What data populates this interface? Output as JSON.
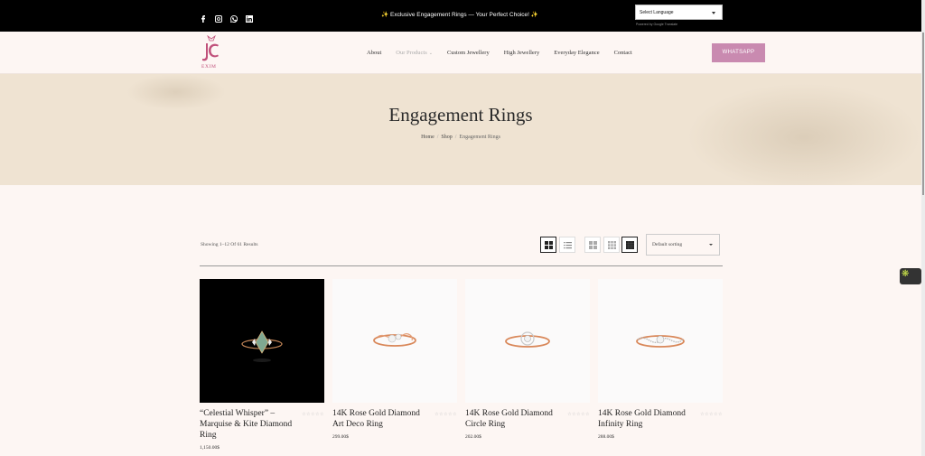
{
  "topbar": {
    "social_icons": [
      "facebook-icon",
      "instagram-icon",
      "whatsapp-icon",
      "linkedin-icon"
    ],
    "promo_text": "Exclusive Engagement Rings — Your Perfect Choice!",
    "promo_spark": "✨",
    "language_select": "Select Language",
    "powered_by": "Powered by Google Translate"
  },
  "header": {
    "logo_text": "JC EXIM",
    "nav": [
      "About",
      "Our Products",
      "Custom Jewellery",
      "High Jewellery",
      "Everyday Elegance",
      "Contact"
    ],
    "whatsapp_label": "WHATSAPP"
  },
  "banner": {
    "title": "Engagement Rings",
    "breadcrumb": [
      "Home",
      "Shop",
      "Engagement Rings"
    ]
  },
  "toolbar": {
    "results_text": "Showing 1–12 Of 61 Results",
    "sorting": "Default sorting"
  },
  "products": [
    {
      "name": "“Celestial Whisper” – Marquise & Kite Diamond Ring",
      "price": "1,150.00$",
      "rating": "☆☆☆☆☆"
    },
    {
      "name": "14K Rose Gold Diamond Art Deco Ring",
      "price": "299.00$",
      "rating": "☆☆☆☆☆"
    },
    {
      "name": "14K Rose Gold Diamond Circle Ring",
      "price": "202.00$",
      "rating": "☆☆☆☆☆"
    },
    {
      "name": "14K Rose Gold Diamond Infinity Ring",
      "price": "288.00$",
      "rating": "☆☆☆☆☆"
    }
  ],
  "colors": {
    "accent": "#c98ab0",
    "banner": "#efe3d2",
    "background": "#fdf6f3",
    "ring_gold": "#d9885a"
  }
}
